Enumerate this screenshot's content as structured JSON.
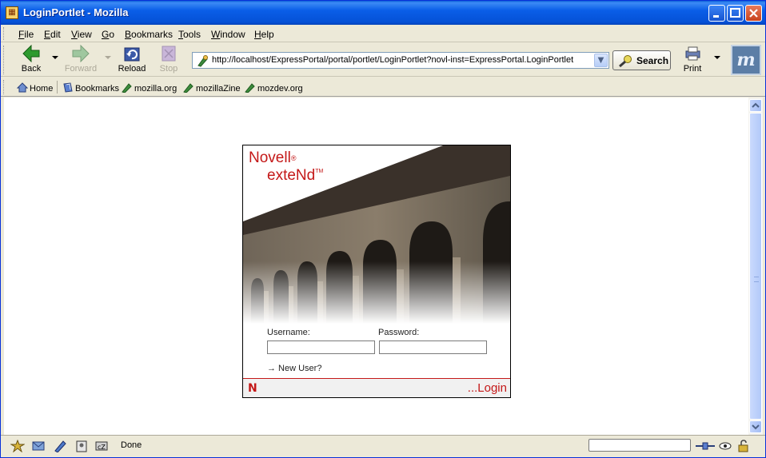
{
  "window": {
    "title": "LoginPortlet - Mozilla",
    "controls": [
      "minimize",
      "maximize",
      "close"
    ]
  },
  "menu": {
    "items": [
      {
        "label": "File",
        "key": "F",
        "rest": "ile"
      },
      {
        "label": "Edit",
        "key": "E",
        "rest": "dit"
      },
      {
        "label": "View",
        "key": "V",
        "rest": "iew"
      },
      {
        "label": "Go",
        "key": "G",
        "rest": "o"
      },
      {
        "label": "Bookmarks",
        "key": "B",
        "rest": "ookmarks"
      },
      {
        "label": "Tools",
        "key": "T",
        "rest": "ools"
      },
      {
        "label": "Window",
        "key": "W",
        "rest": "indow"
      },
      {
        "label": "Help",
        "key": "H",
        "rest": "elp"
      }
    ]
  },
  "toolbar": {
    "back": "Back",
    "forward": "Forward",
    "reload": "Reload",
    "stop": "Stop",
    "url": "http://localhost/ExpressPortal/portal/portlet/LoginPortlet?novl-inst=ExpressPortal.LoginPortlet",
    "search": "Search",
    "print": "Print",
    "throbber_glyph": "m"
  },
  "personal_toolbar": {
    "home": "Home",
    "bookmarks": "Bookmarks",
    "links": [
      "mozilla.org",
      "mozillaZine",
      "mozdev.org"
    ]
  },
  "portlet": {
    "brand_line1": "Novell",
    "brand_mark1": "®",
    "brand_line2": "exteNd",
    "brand_mark2": "TM",
    "username_label": "Username:",
    "username_value": "",
    "password_label": "Password:",
    "password_value": "",
    "new_user": "→ New User?",
    "footer_logo": "N",
    "login_link": "...Login"
  },
  "status": {
    "text": "Done"
  },
  "colors": {
    "brand_red": "#c41818",
    "title_blue": "#0a5ee8"
  }
}
